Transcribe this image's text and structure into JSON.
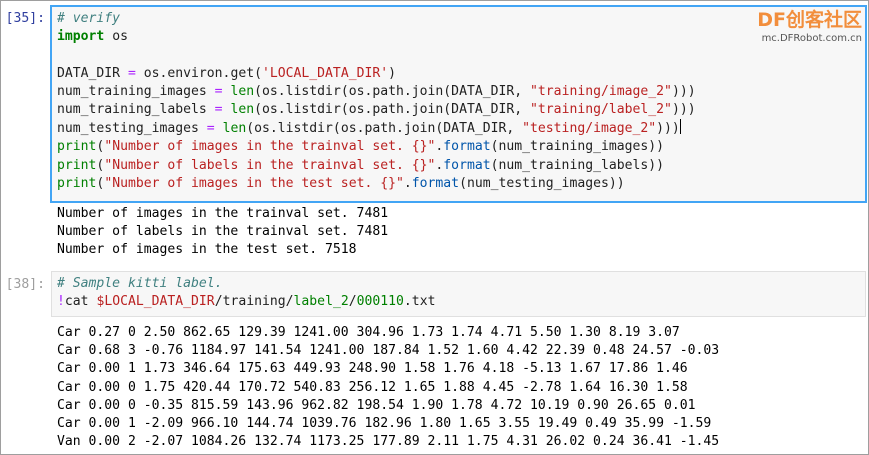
{
  "watermark": {
    "logo_latin": "DF",
    "logo_cn": "创客社区",
    "url": "mc.DFRobot.com.cn"
  },
  "cells": [
    {
      "prompt": "[35]:",
      "code_lines": [
        "# verify",
        "import os",
        "",
        "DATA_DIR = os.environ.get('LOCAL_DATA_DIR')",
        "num_training_images = len(os.listdir(os.path.join(DATA_DIR, \"training/image_2\")))",
        "num_training_labels = len(os.listdir(os.path.join(DATA_DIR, \"training/label_2\")))",
        "num_testing_images = len(os.listdir(os.path.join(DATA_DIR, \"testing/image_2\")))",
        "print(\"Number of images in the trainval set. {}\".format(num_training_images))",
        "print(\"Number of labels in the trainval set. {}\".format(num_training_labels))",
        "print(\"Number of images in the test set. {}\".format(num_testing_images))"
      ],
      "output_lines": [
        "Number of images in the trainval set. 7481",
        "Number of labels in the trainval set. 7481",
        "Number of images in the test set. 7518"
      ]
    },
    {
      "prompt": "[38]:",
      "code_lines": [
        "# Sample kitti label.",
        "!cat $LOCAL_DATA_DIR/training/label_2/000110.txt"
      ],
      "output_lines": [
        "Car 0.27 0 2.50 862.65 129.39 1241.00 304.96 1.73 1.74 4.71 5.50 1.30 8.19 3.07",
        "Car 0.68 3 -0.76 1184.97 141.54 1241.00 187.84 1.52 1.60 4.42 22.39 0.48 24.57 -0.03",
        "Car 0.00 1 1.73 346.64 175.63 449.93 248.90 1.58 1.76 4.18 -5.13 1.67 17.86 1.46",
        "Car 0.00 0 1.75 420.44 170.72 540.83 256.12 1.65 1.88 4.45 -2.78 1.64 16.30 1.58",
        "Car 0.00 0 -0.35 815.59 143.96 962.82 198.54 1.90 1.78 4.72 10.19 0.90 26.65 0.01",
        "Car 0.00 1 -2.09 966.10 144.74 1039.76 182.96 1.80 1.65 3.55 19.49 0.49 35.99 -1.59",
        "Van 0.00 2 -2.07 1084.26 132.74 1173.25 177.89 2.11 1.75 4.31 26.02 0.24 36.41 -1.45"
      ]
    }
  ]
}
